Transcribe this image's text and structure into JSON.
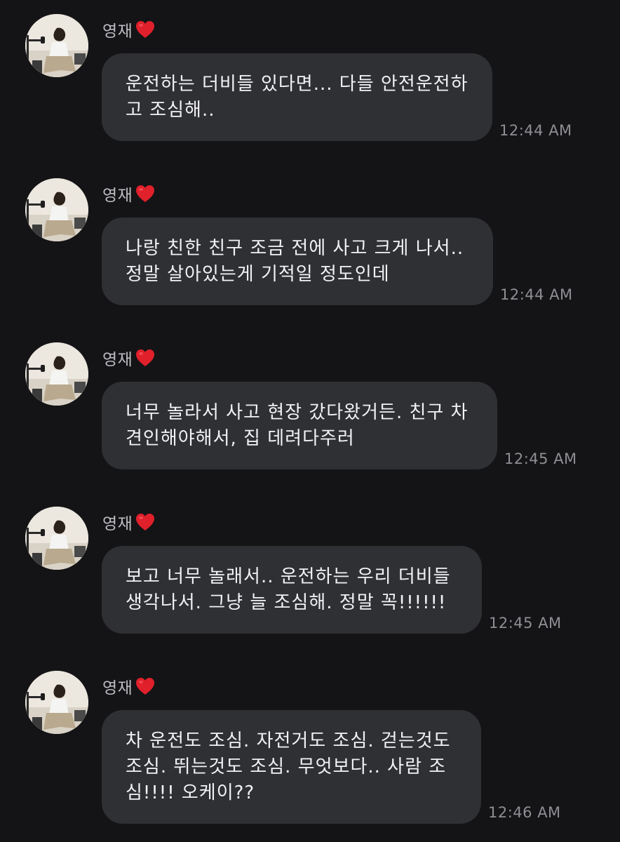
{
  "colors": {
    "background": "#141416",
    "bubble": "#2f3034",
    "message_text": "#f2f2f4",
    "sender_name": "#bcbcc2",
    "timestamp": "#8e8e94",
    "heart": "#e0202b"
  },
  "messages": [
    {
      "sender": "영재",
      "sender_icon": "heart-icon",
      "text": "운전하는 더비들 있다면... 다들 안전운전하\n고 조심해..",
      "time": "12:44 AM"
    },
    {
      "sender": "영재",
      "sender_icon": "heart-icon",
      "text": "나랑 친한 친구 조금 전에 사고 크게 나서..\n정말 살아있는게 기적일 정도인데",
      "time": "12:44 AM"
    },
    {
      "sender": "영재",
      "sender_icon": "heart-icon",
      "text": "너무 놀라서 사고 현장 갔다왔거든. 친구 차\n견인해야해서, 집 데려다주러",
      "time": "12:45 AM"
    },
    {
      "sender": "영재",
      "sender_icon": "heart-icon",
      "text": "보고 너무 놀래서.. 운전하는 우리 더비들\n생각나서. 그냥 늘 조심해. 정말 꼭!!!!!!",
      "time": "12:45 AM"
    },
    {
      "sender": "영재",
      "sender_icon": "heart-icon",
      "text": "차 운전도 조심. 자전거도 조심. 걷는것도\n조심. 뛰는것도 조심. 무엇보다.. 사람 조\n심!!!! 오케이??",
      "time": "12:46 AM"
    }
  ]
}
